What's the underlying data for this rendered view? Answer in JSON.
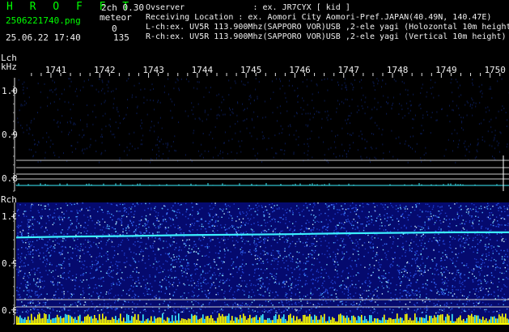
{
  "header": {
    "title": "H R O F F T",
    "channel_mode": "2ch 0.30",
    "filename": "2506221740.png",
    "meteor_label": "meteor",
    "meteor_lch": "0",
    "timestamp": "25.06.22 17:40",
    "meteor_rch": "135"
  },
  "info": {
    "observer": "Ovserver              : ex. JR7CYX [ kid ]",
    "location": "Receiving Location : ex. Aomori City Aomori-Pref.JAPAN(40.49N, 140.47E)",
    "lch": "L-ch:ex. UV5R 113.900Mhz(SAPPORO VOR)USB ,2-ele yagi (Holozontal 10m height)",
    "rch": "R-ch:ex. UV5R 113.900Mhz(SAPPORO VOR)USB ,2-ele yagi (Vertical 10m height)"
  },
  "axis": {
    "lch_label": "Lch",
    "khz_label": "kHz",
    "rch_label": "Rch",
    "x_ticks": [
      "1741",
      "1742",
      "1743",
      "1744",
      "1745",
      "1746",
      "1747",
      "1748",
      "1749",
      "1750"
    ],
    "lch_y_ticks": [
      "1.0",
      "0.9",
      "0.8"
    ],
    "rch_y_ticks": [
      "1.0",
      "0.9",
      "0.8"
    ]
  },
  "colors": {
    "text_green": "#00ff00",
    "text_white": "#f0f0f0",
    "panel_blue": "#050a6e",
    "trace_cyan": "#3cf0ff",
    "bar_yellow": "#ffff00"
  },
  "chart_data": [
    {
      "type": "heatmap",
      "title": "",
      "name": "Lch",
      "xlabel": "",
      "ylabel": "kHz",
      "x_ticks": [
        "1741",
        "1742",
        "1743",
        "1744",
        "1745",
        "1746",
        "1747",
        "1748",
        "1749",
        "1750"
      ],
      "y_ticks": [
        1.0,
        0.9,
        0.8
      ],
      "ylim": [
        0.77,
        1.03
      ],
      "meteor_count": 0
    },
    {
      "type": "heatmap",
      "title": "",
      "name": "Rch",
      "xlabel": "",
      "ylabel": "kHz",
      "x_ticks": [
        "1741",
        "1742",
        "1743",
        "1744",
        "1745",
        "1746",
        "1747",
        "1748",
        "1749",
        "1750"
      ],
      "y_ticks": [
        1.0,
        0.9,
        0.8
      ],
      "ylim": [
        0.77,
        1.03
      ],
      "carrier_khz": [
        0.955,
        0.957,
        0.958,
        0.96,
        0.961,
        0.962,
        0.964,
        0.965,
        0.966,
        0.966
      ],
      "meteor_count": 135
    }
  ]
}
